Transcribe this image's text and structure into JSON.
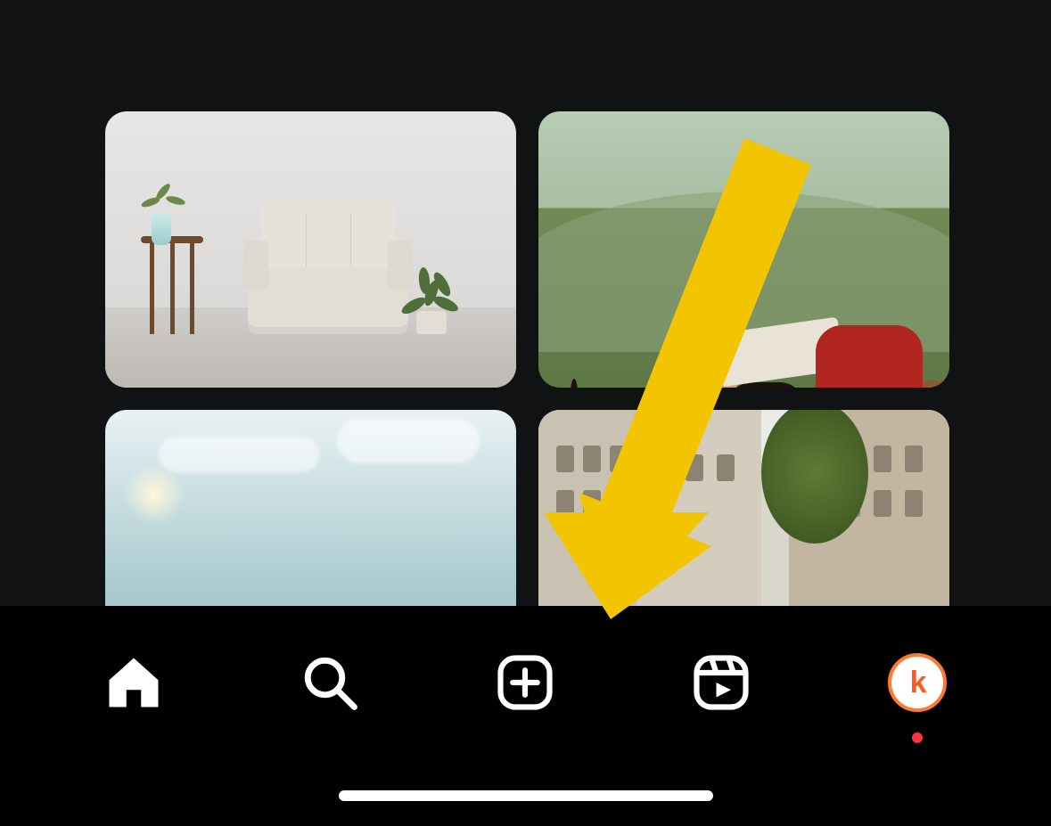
{
  "annotation": {
    "arrow_color": "#f3c400",
    "target_nav_item": "create"
  },
  "grid": {
    "items": [
      {
        "name": "thumb-room-interior"
      },
      {
        "name": "thumb-friends-hiking"
      },
      {
        "name": "thumb-group-jumping"
      },
      {
        "name": "thumb-couple-city"
      }
    ]
  },
  "nav": {
    "items": [
      {
        "name": "home",
        "icon": "home-icon",
        "active": true
      },
      {
        "name": "search",
        "icon": "search-icon",
        "active": false
      },
      {
        "name": "create",
        "icon": "plus-icon",
        "active": false
      },
      {
        "name": "reels",
        "icon": "reels-icon",
        "active": false
      },
      {
        "name": "profile",
        "icon": "avatar",
        "active": false,
        "notification_dot": true,
        "avatar_letter": "k"
      }
    ]
  },
  "colors": {
    "background": "#000000",
    "content_bg": "#111213",
    "icon": "#ffffff",
    "avatar_ring": "#ff7a2f",
    "avatar_letter": "#ff5a1f",
    "notification_dot": "#ff3040"
  }
}
